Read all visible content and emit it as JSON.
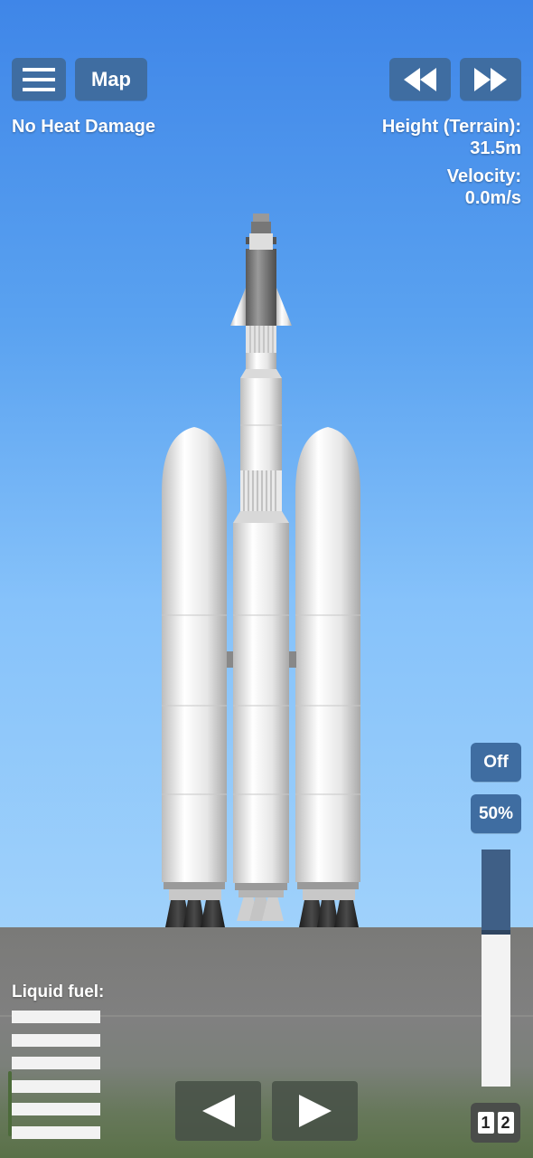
{
  "hud": {
    "menu_icon": "hamburger-icon",
    "map_label": "Map",
    "rewind_icon": "rewind-icon",
    "fast_forward_icon": "fast-forward-icon",
    "heat_status": "No Heat Damage",
    "height_label": "Height (Terrain):",
    "height_value": "31.5m",
    "velocity_label": "Velocity:",
    "velocity_value": "0.0m/s"
  },
  "controls": {
    "engine_toggle": "Off",
    "throttle_percent_label": "50%",
    "throttle_fraction": 0.35,
    "left_icon": "rotate-left-icon",
    "right_icon": "rotate-right-icon",
    "stage_numbers": [
      "1",
      "2"
    ]
  },
  "resources": {
    "liquid_fuel_label": "Liquid fuel:",
    "fuel_bar_count": 6
  },
  "colors": {
    "button_blue": "#3f6da1",
    "sky_top": "#3f86e8",
    "sky_bottom": "#9fd1fb",
    "ground": "#7a7a78"
  }
}
